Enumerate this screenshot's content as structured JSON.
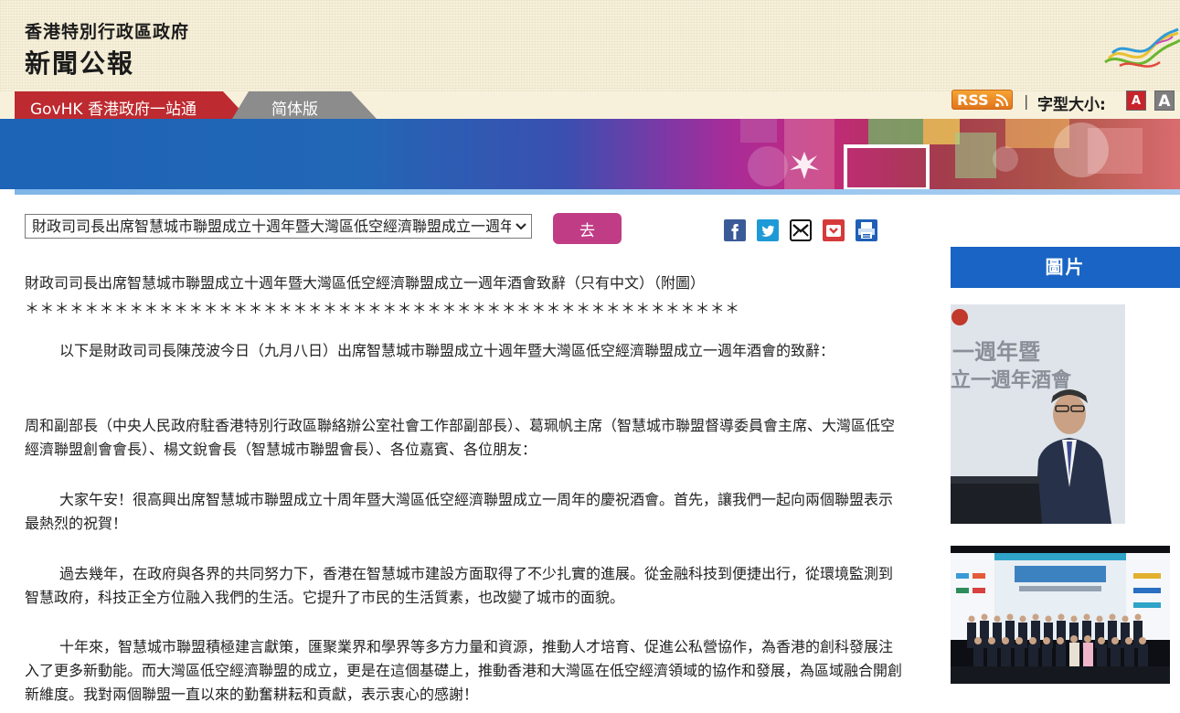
{
  "header": {
    "gov_name": "香港特別行政區政府",
    "press_title": "新聞公報"
  },
  "tabs": {
    "govhk": "GovHK 香港政府一站通",
    "simplified": "简体版"
  },
  "tools": {
    "rss": "RSS",
    "separator": "|",
    "font_size_label": "字型大小:",
    "font_small": "A",
    "font_large": "A"
  },
  "toolbar": {
    "selected_article": "財政司司長出席智慧城市聯盟成立十週年暨大灣區低空經濟聯盟成立一週年酒會致辭（只有中文）（附圖）",
    "go_label": "去"
  },
  "share_icons": [
    "facebook-icon",
    "twitter-icon",
    "email-icon",
    "bookmark-icon",
    "print-icon"
  ],
  "article": {
    "title": "財政司司長出席智慧城市聯盟成立十週年暨大灣區低空經濟聯盟成立一週年酒會致辭（只有中文）（附圖）",
    "stars": "＊＊＊＊＊＊＊＊＊＊＊＊＊＊＊＊＊＊＊＊＊＊＊＊＊＊＊＊＊＊＊＊＊＊＊＊＊＊＊＊＊＊＊＊＊＊＊＊",
    "paragraphs": [
      "以下是財政司司長陳茂波今日（九月八日）出席智慧城市聯盟成立十週年暨大灣區低空經濟聯盟成立一週年酒會的致辭：",
      "周和副部長（中央人民政府駐香港特別行政區聯絡辦公室社會工作部副部長）、葛珮帆主席（智慧城市聯盟督導委員會主席、大灣區低空經濟聯盟創會會長）、楊文銳會長（智慧城市聯盟會長）、各位嘉賓、各位朋友：",
      "大家午安！很高興出席智慧城市聯盟成立十周年暨大灣區低空經濟聯盟成立一周年的慶祝酒會。首先，讓我們一起向兩個聯盟表示最熱烈的祝賀！",
      "過去幾年，在政府與各界的共同努力下，香港在智慧城市建設方面取得了不少扎實的進展。從金融科技到便捷出行，從環境監測到智慧政府，科技正全方位融入我們的生活。它提升了市民的生活質素，也改變了城市的面貌。",
      "十年來，智慧城市聯盟積極建言獻策，匯聚業界和學界等多方力量和資源，推動人才培育、促進公私營協作，為香港的創科發展注入了更多新動能。而大灣區低空經濟聯盟的成立，更是在這個基礎上，推動香港和大灣區在低空經濟領域的協作和發展，為區域融合開創新維度。我對兩個聯盟一直以來的勤奮耕耘和貢獻，表示衷心的感謝！"
    ]
  },
  "sidebar": {
    "pictures_header": "圖片",
    "photo1_backdrop_line1": "一週年暨",
    "photo1_backdrop_line2": "立一週年酒會"
  },
  "colors": {
    "govhk_tab": "#bd2a2f",
    "simplified_tab": "#8c8c8c",
    "go_button": "#c03d86",
    "pictures_header": "#1964c4",
    "header_bg": "#f7f1dc"
  }
}
